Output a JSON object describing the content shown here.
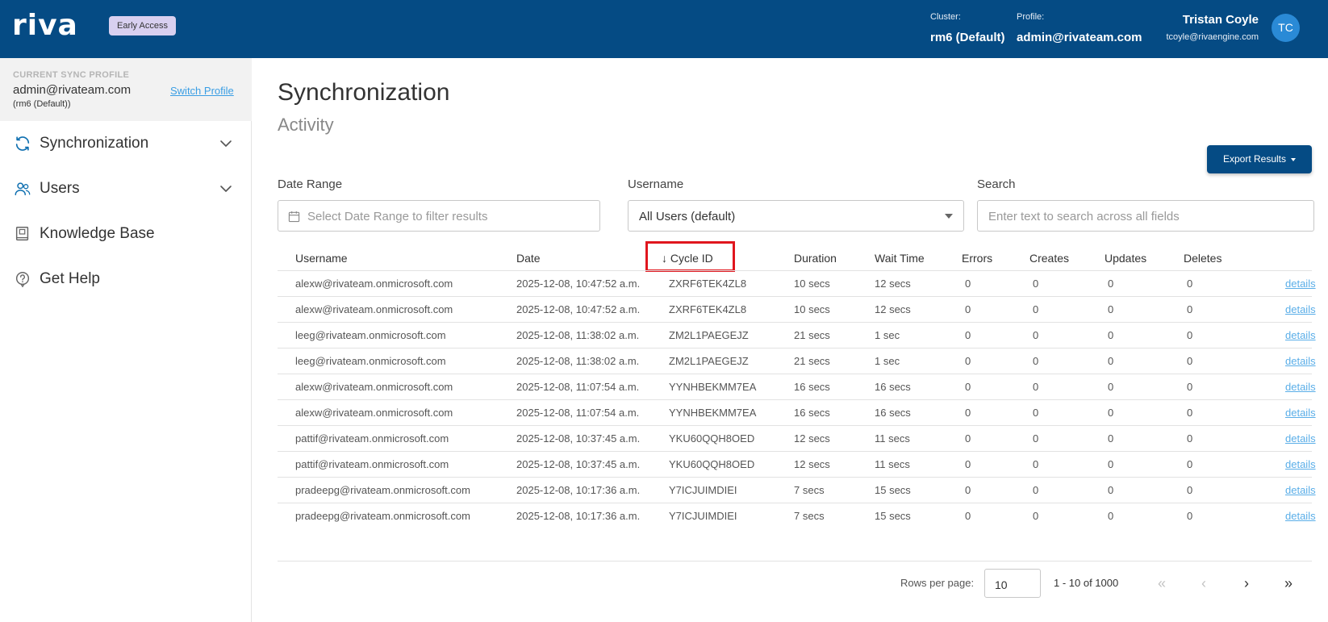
{
  "header": {
    "logo": "riva",
    "badge": "Early Access",
    "cluster_label": "Cluster:",
    "cluster_value": "rm6 (Default)",
    "profile_label": "Profile:",
    "profile_value": "admin@rivateam.com",
    "user_name": "Tristan Coyle",
    "user_email": "tcoyle@rivaengine.com",
    "avatar_initials": "TC"
  },
  "sidebar": {
    "profile_caption": "CURRENT SYNC PROFILE",
    "profile_email": "admin@rivateam.com",
    "profile_cluster": "(rm6 (Default))",
    "switch_label": "Switch Profile",
    "items": [
      {
        "label": "Synchronization",
        "icon": "sync-icon",
        "expandable": true
      },
      {
        "label": "Users",
        "icon": "users-icon",
        "expandable": true
      },
      {
        "label": "Knowledge Base",
        "icon": "book-icon",
        "expandable": false
      },
      {
        "label": "Get Help",
        "icon": "help-icon",
        "expandable": false
      }
    ]
  },
  "main": {
    "title": "Synchronization",
    "subtitle": "Activity",
    "export_label": "Export Results",
    "filters": {
      "date_range_label": "Date Range",
      "date_range_placeholder": "Select Date Range to filter results",
      "username_label": "Username",
      "username_value": "All Users (default)",
      "search_label": "Search",
      "search_placeholder": "Enter text to search across all fields"
    },
    "table": {
      "sort_arrow": "↓",
      "columns": [
        "Username",
        "Date",
        "Cycle ID",
        "Duration",
        "Wait Time",
        "Errors",
        "Creates",
        "Updates",
        "Deletes"
      ],
      "details_label": "details",
      "rows": [
        {
          "username": "alexw@rivateam.onmicrosoft.com",
          "date": "2025-12-08, 10:47:52 a.m.",
          "cycle": "ZXRF6TEK4ZL8",
          "duration": "10 secs",
          "wait": "12 secs",
          "errors": "0",
          "creates": "0",
          "updates": "0",
          "deletes": "0"
        },
        {
          "username": "alexw@rivateam.onmicrosoft.com",
          "date": "2025-12-08, 10:47:52 a.m.",
          "cycle": "ZXRF6TEK4ZL8",
          "duration": "10 secs",
          "wait": "12 secs",
          "errors": "0",
          "creates": "0",
          "updates": "0",
          "deletes": "0"
        },
        {
          "username": "leeg@rivateam.onmicrosoft.com",
          "date": "2025-12-08, 11:38:02 a.m.",
          "cycle": "ZM2L1PAEGEJZ",
          "duration": "21 secs",
          "wait": "1 sec",
          "errors": "0",
          "creates": "0",
          "updates": "0",
          "deletes": "0"
        },
        {
          "username": "leeg@rivateam.onmicrosoft.com",
          "date": "2025-12-08, 11:38:02 a.m.",
          "cycle": "ZM2L1PAEGEJZ",
          "duration": "21 secs",
          "wait": "1 sec",
          "errors": "0",
          "creates": "0",
          "updates": "0",
          "deletes": "0"
        },
        {
          "username": "alexw@rivateam.onmicrosoft.com",
          "date": "2025-12-08, 11:07:54 a.m.",
          "cycle": "YYNHBEKMM7EA",
          "duration": "16 secs",
          "wait": "16 secs",
          "errors": "0",
          "creates": "0",
          "updates": "0",
          "deletes": "0"
        },
        {
          "username": "alexw@rivateam.onmicrosoft.com",
          "date": "2025-12-08, 11:07:54 a.m.",
          "cycle": "YYNHBEKMM7EA",
          "duration": "16 secs",
          "wait": "16 secs",
          "errors": "0",
          "creates": "0",
          "updates": "0",
          "deletes": "0"
        },
        {
          "username": "pattif@rivateam.onmicrosoft.com",
          "date": "2025-12-08, 10:37:45 a.m.",
          "cycle": "YKU60QQH8OED",
          "duration": "12 secs",
          "wait": "11 secs",
          "errors": "0",
          "creates": "0",
          "updates": "0",
          "deletes": "0"
        },
        {
          "username": "pattif@rivateam.onmicrosoft.com",
          "date": "2025-12-08, 10:37:45 a.m.",
          "cycle": "YKU60QQH8OED",
          "duration": "12 secs",
          "wait": "11 secs",
          "errors": "0",
          "creates": "0",
          "updates": "0",
          "deletes": "0"
        },
        {
          "username": "pradeepg@rivateam.onmicrosoft.com",
          "date": "2025-12-08, 10:17:36 a.m.",
          "cycle": "Y7ICJUIMDIEI",
          "duration": "7 secs",
          "wait": "15 secs",
          "errors": "0",
          "creates": "0",
          "updates": "0",
          "deletes": "0"
        },
        {
          "username": "pradeepg@rivateam.onmicrosoft.com",
          "date": "2025-12-08, 10:17:36 a.m.",
          "cycle": "Y7ICJUIMDIEI",
          "duration": "7 secs",
          "wait": "15 secs",
          "errors": "0",
          "creates": "0",
          "updates": "0",
          "deletes": "0"
        }
      ]
    },
    "pagination": {
      "rows_per_page_label": "Rows per page:",
      "rows_per_page": "10",
      "range": "1 - 10 of 1000",
      "first": "«",
      "prev": "‹",
      "next": "›",
      "last": "»"
    }
  },
  "colors": {
    "header_bg": "#054b84",
    "accent": "#3a9ee4",
    "sort_highlight": "#e0161e",
    "badge_bg": "#d8d0f0"
  }
}
